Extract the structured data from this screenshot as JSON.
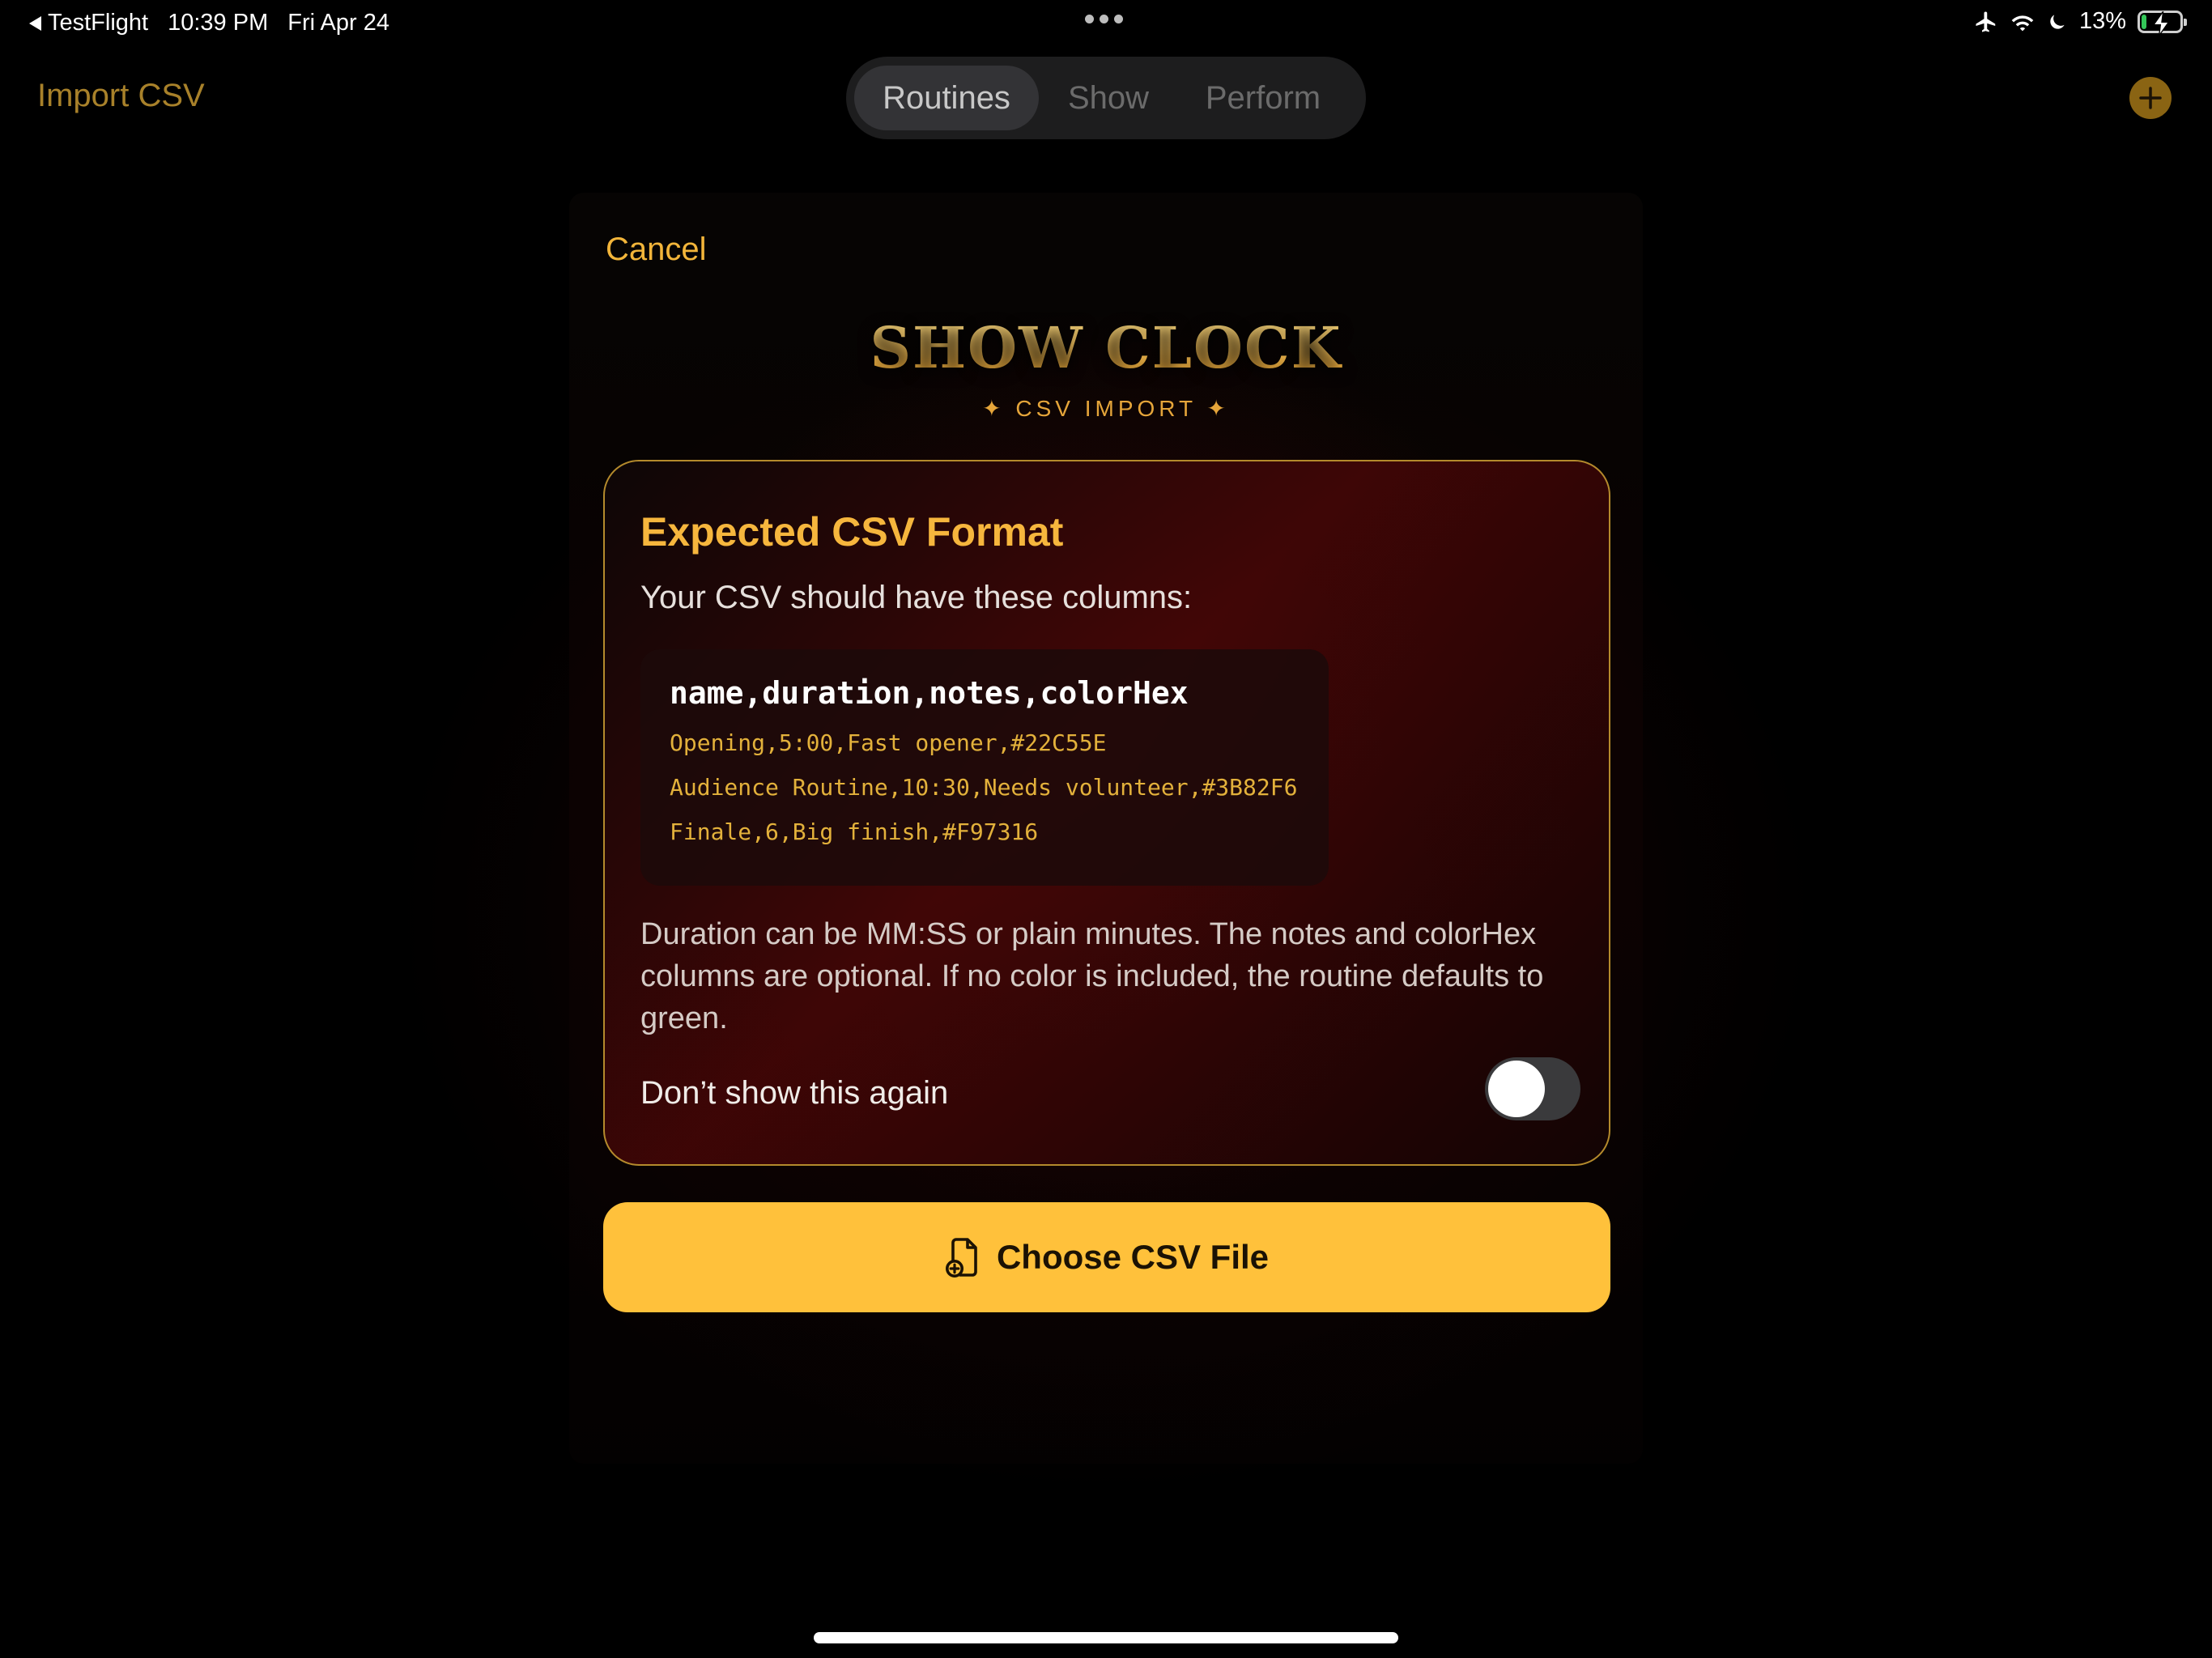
{
  "status_bar": {
    "back_app": "TestFlight",
    "time": "10:39 PM",
    "date": "Fri Apr 24",
    "battery_percent": "13%",
    "battery_level": 0.13,
    "icons": [
      "airplane-icon",
      "wifi-icon",
      "moon-icon",
      "battery-charging-icon"
    ]
  },
  "nav": {
    "left_action": "Import CSV",
    "tabs": [
      {
        "label": "Routines",
        "active": true
      },
      {
        "label": "Show",
        "active": false
      },
      {
        "label": "Perform",
        "active": false
      }
    ],
    "add_icon": "plus-circle-icon"
  },
  "sheet": {
    "cancel": "Cancel",
    "title": "SHOW CLOCK",
    "subtitle": "✦ CSV IMPORT ✦",
    "card": {
      "title": "Expected CSV Format",
      "intro": "Your CSV should have these columns:",
      "code_header": "name,duration,notes,colorHex",
      "code_rows": [
        "Opening,5:00,Fast opener,#22C55E",
        "Audience Routine,10:30,Needs volunteer,#3B82F6",
        "Finale,6,Big finish,#F97316"
      ],
      "description": "Duration can be MM:SS or plain minutes. The notes and colorHex columns are optional. If no color is included, the routine defaults to green.",
      "toggle_label": "Don’t show this again",
      "toggle_on": false
    },
    "choose_button": "Choose CSV File",
    "choose_icon": "document-add-icon"
  },
  "colors": {
    "accent_gold": "#F6B63D",
    "button_yellow": "#FFC13B",
    "background": "#000000"
  }
}
